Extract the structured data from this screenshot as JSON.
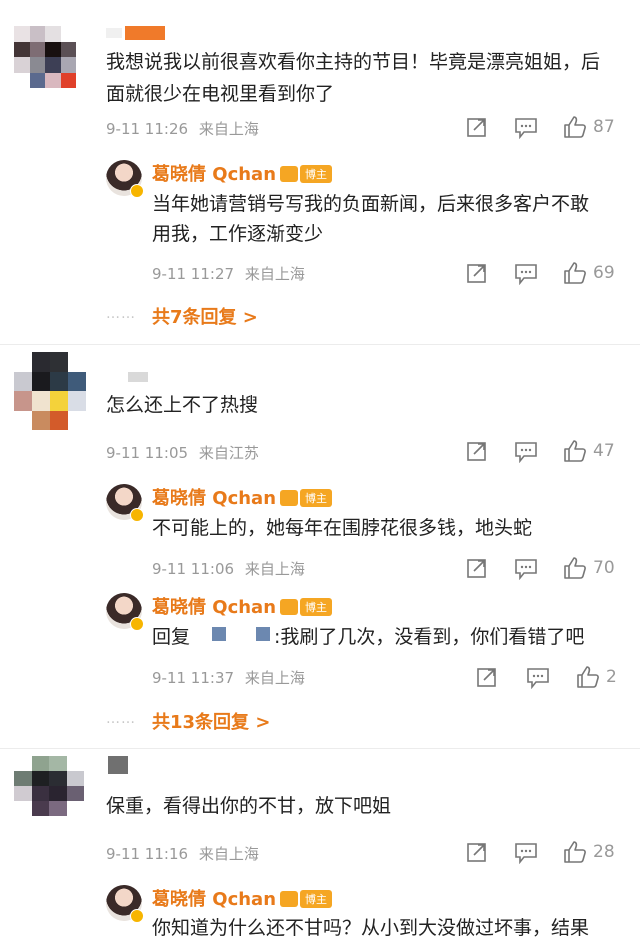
{
  "colors": {
    "accent": "#e87a1a",
    "meta": "#999999",
    "badge": "#f5a623"
  },
  "comments": [
    {
      "text_line1": "我想说我以前很喜欢看你主持的节目！毕竟是漂亮姐姐，后",
      "text_line2": "面就很少在电视里看到你了",
      "time": "9-11 11:26",
      "location": "来自上海",
      "likes": "87",
      "replies": [
        {
          "name": "葛晓倩 Qchan",
          "badge": "博主",
          "text_line1": "当年她请营销号写我的负面新闻，后来很多客户不敢",
          "text_line2": "用我，工作逐渐变少",
          "time": "9-11 11:27",
          "location": "来自上海",
          "likes": "69"
        }
      ],
      "more": "共7条回复 >"
    },
    {
      "text_line1": "怎么还上不了热搜",
      "time": "9-11 11:05",
      "location": "来自江苏",
      "likes": "47",
      "replies": [
        {
          "name": "葛晓倩 Qchan",
          "badge": "博主",
          "text_line1": "不可能上的，她每年在围脖花很多钱，地头蛇",
          "time": "9-11 11:06",
          "location": "来自上海",
          "likes": "70"
        },
        {
          "name": "葛晓倩 Qchan",
          "badge": "博主",
          "reply_prefix": "回复",
          "text_line1": ":我刷了几次，没看到，你们看错了吧",
          "time": "9-11 11:37",
          "location": "来自上海",
          "likes": "2"
        }
      ],
      "more": "共13条回复 >"
    },
    {
      "text_line1": "保重，看得出你的不甘，放下吧姐",
      "time": "9-11 11:16",
      "location": "来自上海",
      "likes": "28",
      "replies": [
        {
          "name": "葛晓倩 Qchan",
          "badge": "博主",
          "text_line1": "你知道为什么还不甘吗？从小到大没做过坏事，结果"
        }
      ]
    }
  ],
  "icons": {
    "share": "share-icon",
    "comment": "comment-icon",
    "like": "like-icon"
  }
}
